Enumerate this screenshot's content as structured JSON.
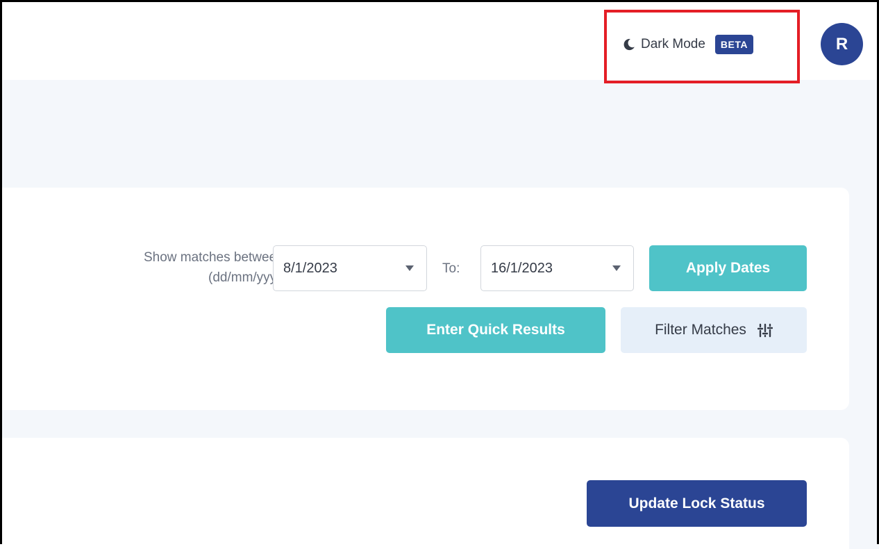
{
  "header": {
    "dark_mode": {
      "icon": "moon-icon",
      "label": "Dark Mode",
      "badge": "BETA"
    },
    "avatar": {
      "initial": "R"
    }
  },
  "filters": {
    "show_label_line1": "Show matches between:",
    "show_label_line2": "(dd/mm/yyyy)",
    "from_date": "8/1/2023",
    "to_label": "To:",
    "to_date": "16/1/2023",
    "apply_button": "Apply Dates",
    "quick_results_button": "Enter Quick Results",
    "filter_matches_button": "Filter Matches",
    "filter_icon": "sliders-icon"
  },
  "lock": {
    "update_button": "Update Lock Status"
  },
  "colors": {
    "primary": "#2b4594",
    "teal": "#4fc3c8",
    "highlight": "#e41e26"
  }
}
